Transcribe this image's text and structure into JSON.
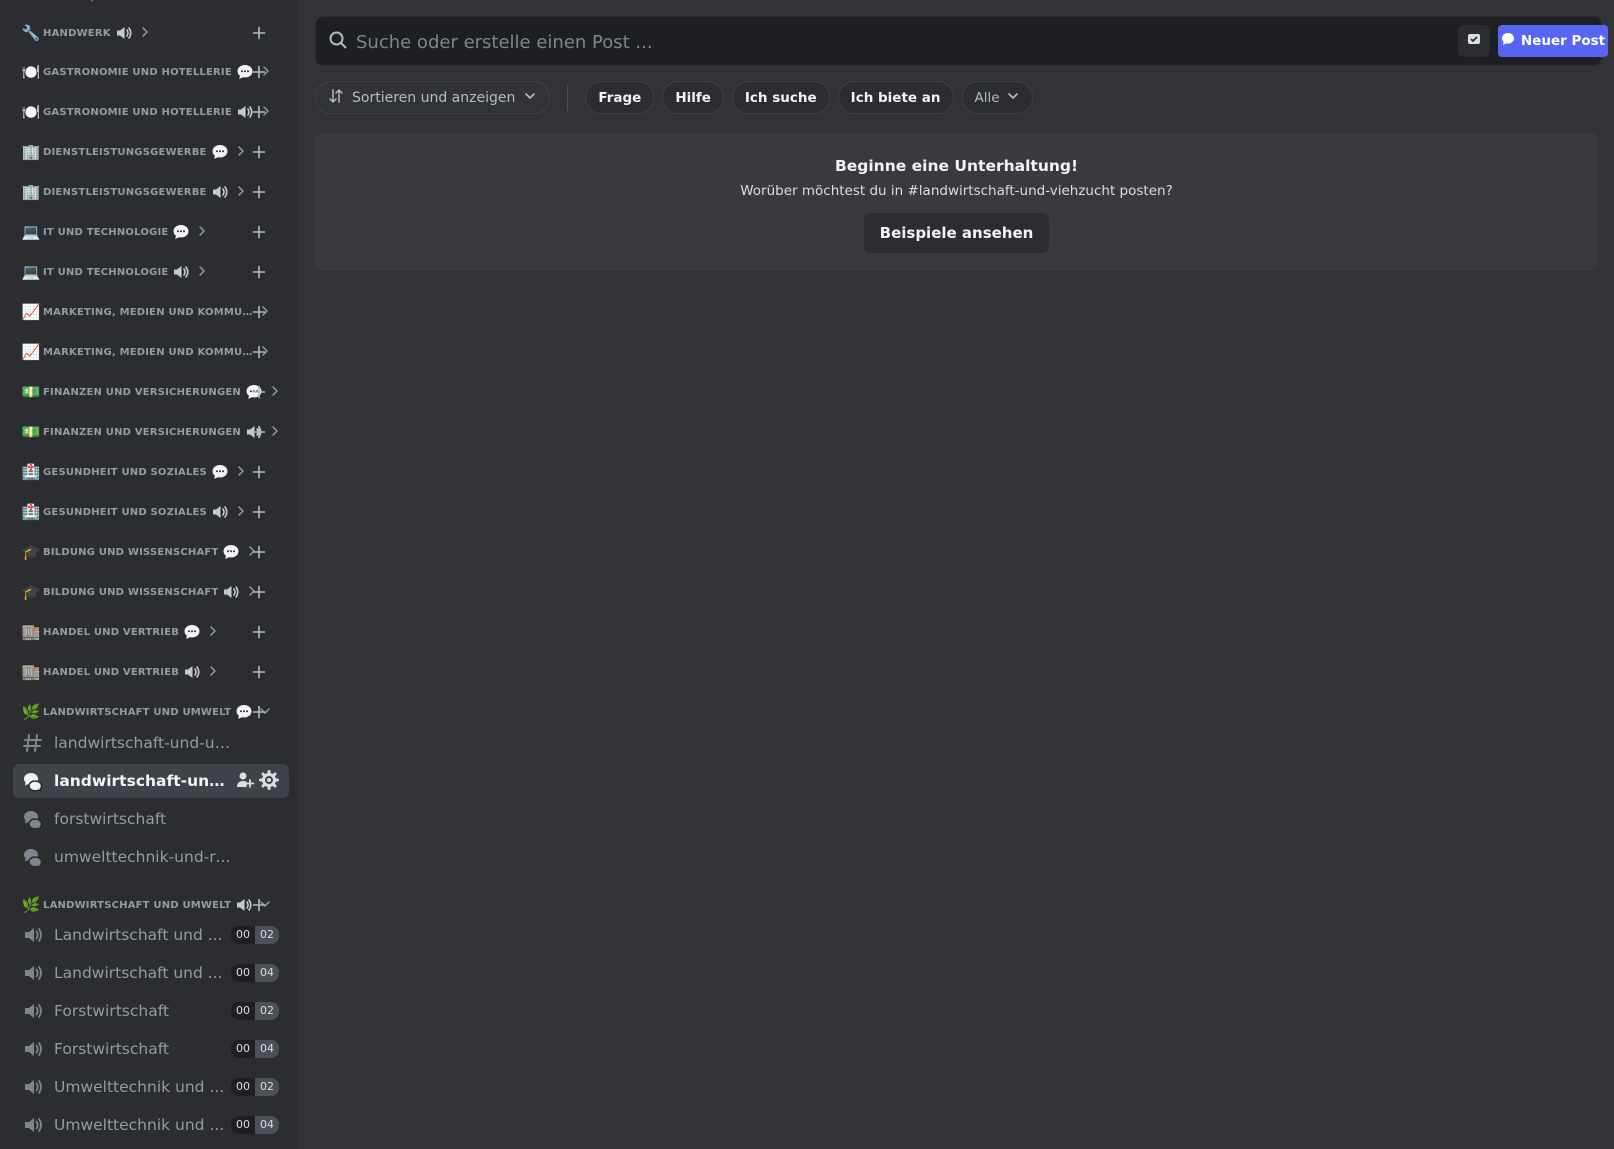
{
  "sidebar": {
    "categories": [
      {
        "emoji": "🔧",
        "name": "Handwerk",
        "badge": "speaker"
      },
      {
        "emoji": "🍽️",
        "name": "Gastronomie und Hotellerie",
        "badge": "bubble"
      },
      {
        "emoji": "🍽️",
        "name": "Gastronomie und Hotellerie",
        "badge": "speaker"
      },
      {
        "emoji": "🏢",
        "name": "Dienstleistungsgewerbe",
        "badge": "bubble"
      },
      {
        "emoji": "🏢",
        "name": "Dienstleistungsgewerbe",
        "badge": "speaker"
      },
      {
        "emoji": "💻",
        "name": "IT und Technologie",
        "badge": "bubble"
      },
      {
        "emoji": "💻",
        "name": "IT und Technologie",
        "badge": "speaker"
      },
      {
        "emoji": "📈",
        "name": "Marketing, Medien und Kommuni...",
        "badge": ""
      },
      {
        "emoji": "📈",
        "name": "Marketing, Medien und Kommuni...",
        "badge": ""
      },
      {
        "emoji": "💵",
        "name": "Finanzen und Versicherungen",
        "badge": "bubble"
      },
      {
        "emoji": "💵",
        "name": "Finanzen und Versicherungen",
        "badge": "speaker"
      },
      {
        "emoji": "🏥",
        "name": "Gesundheit und Soziales",
        "badge": "bubble"
      },
      {
        "emoji": "🏥",
        "name": "Gesundheit und Soziales",
        "badge": "speaker"
      },
      {
        "emoji": "🎓",
        "name": "Bildung und Wissenschaft",
        "badge": "bubble"
      },
      {
        "emoji": "🎓",
        "name": "Bildung und Wissenschaft",
        "badge": "speaker"
      },
      {
        "emoji": "🏬",
        "name": "Handel und Vertrieb",
        "badge": "bubble"
      },
      {
        "emoji": "🏬",
        "name": "Handel und Vertrieb",
        "badge": "speaker"
      },
      {
        "emoji": "🌿",
        "name": "Landwirtschaft und Umwelt",
        "badge": "bubble"
      }
    ],
    "text_channels": [
      {
        "type": "text",
        "label": "landwirtschaft-und-umwelt"
      },
      {
        "type": "forum",
        "label": "landwirtschaft-und-viehzucht",
        "active": true
      },
      {
        "type": "forum",
        "label": "forstwirtschaft"
      },
      {
        "type": "forum",
        "label": "umwelttechnik-und-recycling"
      }
    ],
    "voice_category": {
      "emoji": "🌿",
      "name": "Landwirtschaft und Umwelt",
      "badge": "speaker"
    },
    "voice_channels": [
      {
        "label": "Landwirtschaft und ...",
        "count_a": "00",
        "count_b": "02"
      },
      {
        "label": "Landwirtschaft und ...",
        "count_a": "00",
        "count_b": "04"
      },
      {
        "label": "Forstwirtschaft",
        "count_a": "00",
        "count_b": "02"
      },
      {
        "label": "Forstwirtschaft",
        "count_a": "00",
        "count_b": "04"
      },
      {
        "label": "Umwelttechnik und ...",
        "count_a": "00",
        "count_b": "02"
      },
      {
        "label": "Umwelttechnik und ...",
        "count_a": "00",
        "count_b": "04"
      }
    ]
  },
  "main": {
    "search_placeholder": "Suche oder erstelle einen Post ...",
    "new_post_label": "Neuer Post",
    "sort_label": "Sortieren und anzeigen",
    "tags": [
      "Frage",
      "Hilfe",
      "Ich suche",
      "Ich biete an"
    ],
    "all_label": "Alle",
    "empty": {
      "title": "Beginne eine Unterhaltung!",
      "subtitle": "Worüber möchtest du in #landwirtschaft-und-viehzucht posten?",
      "button": "Beispiele ansehen"
    }
  },
  "colors": {
    "accent": "#5865f2",
    "sidebar_bg": "#2b2d31",
    "main_bg": "#313338"
  }
}
